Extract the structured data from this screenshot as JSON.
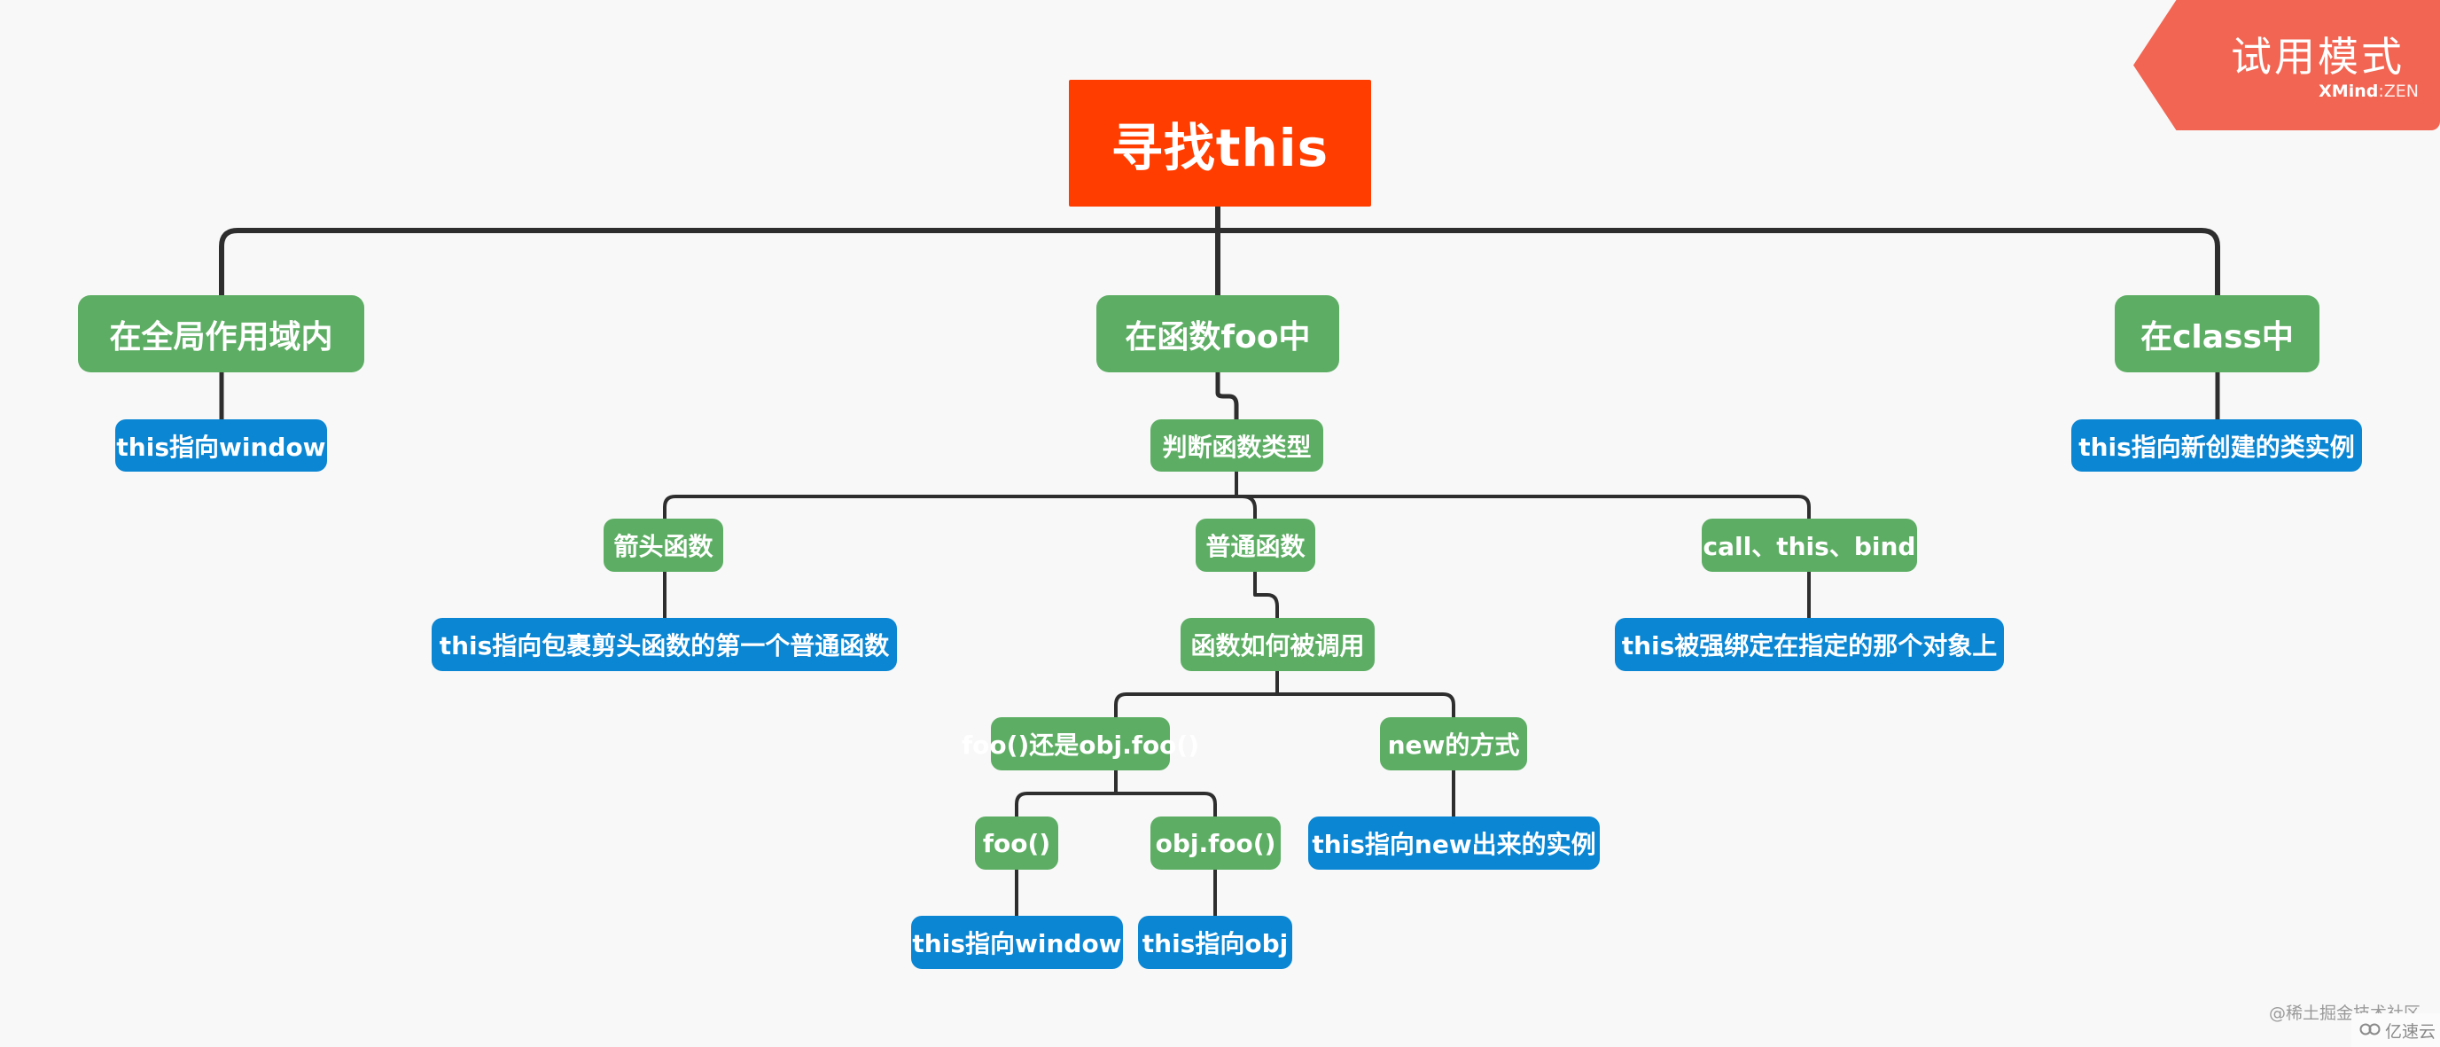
{
  "mindmap": {
    "root": {
      "label": "寻找this"
    },
    "branches": {
      "global": {
        "label": "在全局作用域内",
        "result": "this指向window"
      },
      "function": {
        "label": "在函数foo中",
        "judge": "判断函数类型",
        "arrow": {
          "label": "箭头函数",
          "result": "this指向包裹剪头函数的第一个普通函数"
        },
        "normal": {
          "label": "普通函数",
          "how_called": "函数如何被调用",
          "call_style": {
            "label": "foo()还是obj.foo()",
            "plain": {
              "label": "foo()",
              "result": "this指向window"
            },
            "method": {
              "label": "obj.foo()",
              "result": "this指向obj"
            }
          },
          "new_style": {
            "label": "new的方式",
            "result": "this指向new出来的实例"
          }
        },
        "explicit": {
          "label": "call、this、bind",
          "result": "this被强绑定在指定的那个对象上"
        }
      },
      "class": {
        "label": "在class中",
        "result": "this指向新创建的类实例"
      }
    }
  },
  "trial_badge": {
    "title": "试用模式",
    "brand_bold": "XMind",
    "brand_sep": ":",
    "brand_light": "ZEN"
  },
  "watermarks": {
    "community": "@稀土掘金技术社区",
    "site": "亿速云",
    "site_icon": "cloud-icon"
  },
  "colors": {
    "root": "#FF3D00",
    "topic": "#5DAE64",
    "leaf": "#0A86D3",
    "connector": "#2E2E2E",
    "badge": "#F26552",
    "background": "#F8F8F8"
  }
}
